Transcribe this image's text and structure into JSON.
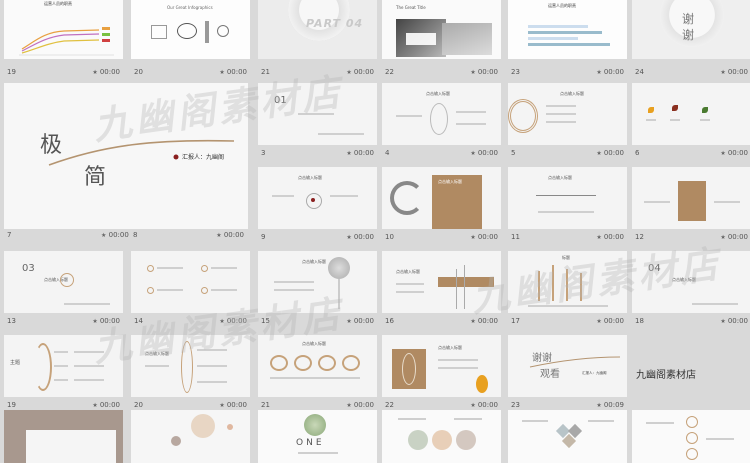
{
  "slides": {
    "row1": [
      {
        "num": "19",
        "dur": "00:00",
        "title": "运营人员的职责",
        "chart": "line"
      },
      {
        "num": "20",
        "dur": "00:00",
        "title": "Our Great Infographics"
      },
      {
        "num": "21",
        "dur": "00:00",
        "title": "PART 04"
      },
      {
        "num": "22",
        "dur": "00:00",
        "title": "The Great Title"
      },
      {
        "num": "23",
        "dur": "00:00",
        "title": "运营人员的职责"
      },
      {
        "num": "24",
        "dur": "00:00",
        "title": "谢 谢"
      }
    ],
    "row2": [
      {
        "num": "7",
        "dur": ""
      },
      {
        "num": "8",
        "dur": "00:00"
      },
      {
        "num": "3",
        "dur": "00:00",
        "label": "01"
      },
      {
        "num": "4",
        "dur": "00:00",
        "label": "点击输入标题"
      },
      {
        "num": "5",
        "dur": "00:00",
        "label": "点击输入标题"
      },
      {
        "num": "6",
        "dur": "00:00"
      }
    ],
    "big7": {
      "char1": "极",
      "char2": "简",
      "reporter": "汇报人：九幽阁"
    },
    "row3": [
      {
        "num": "9",
        "dur": "00:00",
        "label": "点击输入标题"
      },
      {
        "num": "10",
        "dur": "00:00",
        "label": "点击输入标题"
      },
      {
        "num": "11",
        "dur": "00:00",
        "label": "点击输入标题"
      },
      {
        "num": "12",
        "dur": "00:00"
      }
    ],
    "row4": [
      {
        "num": "13",
        "dur": "00:00",
        "label": "03",
        "sub": "点击输入标题"
      },
      {
        "num": "14",
        "dur": "00:00"
      },
      {
        "num": "15",
        "dur": "00:00",
        "label": "点击输入标题"
      },
      {
        "num": "16",
        "dur": "00:00",
        "label": "点击输入标题"
      },
      {
        "num": "17",
        "dur": "00:00",
        "label": "标题"
      },
      {
        "num": "18",
        "dur": "00:00",
        "label": "04",
        "sub": "点击输入标题"
      }
    ],
    "row5": [
      {
        "num": "19",
        "dur": "00:00",
        "label": "主题"
      },
      {
        "num": "20",
        "dur": "00:00",
        "label": "点击输入标题"
      },
      {
        "num": "21",
        "dur": "00:00",
        "label": "点击输入标题"
      },
      {
        "num": "22",
        "dur": "00:00",
        "label": "点击输入标题"
      },
      {
        "num": "23",
        "dur": "00:09",
        "label1": "谢谢",
        "label2": "观看",
        "sub": "汇报人：九幽阁"
      }
    ],
    "brand": "九幽阁素材店",
    "row6": [
      {
        "label": "ONE"
      }
    ]
  },
  "watermark": "九幽阁素材店",
  "colors": {
    "accent": "#c6a27a",
    "bg": "#d9d9d9",
    "slide": "#f4f4f4"
  }
}
